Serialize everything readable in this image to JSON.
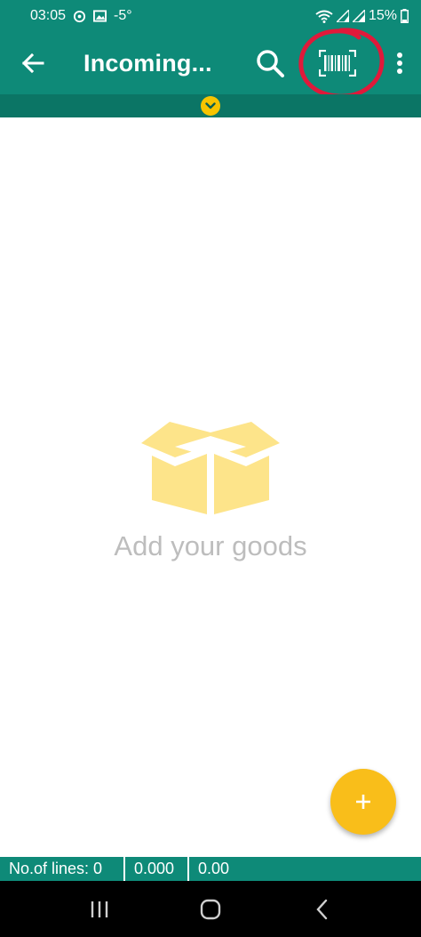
{
  "status_bar": {
    "time": "03:05",
    "temperature": "-5°",
    "battery": "15%"
  },
  "app_bar": {
    "title": "Incoming...",
    "icons": {
      "back": "arrow-left-icon",
      "search": "search-icon",
      "scan": "barcode-scan-icon",
      "more": "more-vert-icon"
    }
  },
  "empty_state": {
    "icon": "open-box-icon",
    "message": "Add your goods"
  },
  "fab": {
    "label": "+"
  },
  "footer": {
    "lines": "No.of lines: 0",
    "quantity": "0.000",
    "amount": "0.00"
  },
  "colors": {
    "primary": "#0e8a78",
    "strip": "#0b7565",
    "accent": "#f9be1a",
    "box": "#fde48a",
    "empty_text": "#bdbdbd",
    "annotation": "#e0193a"
  }
}
